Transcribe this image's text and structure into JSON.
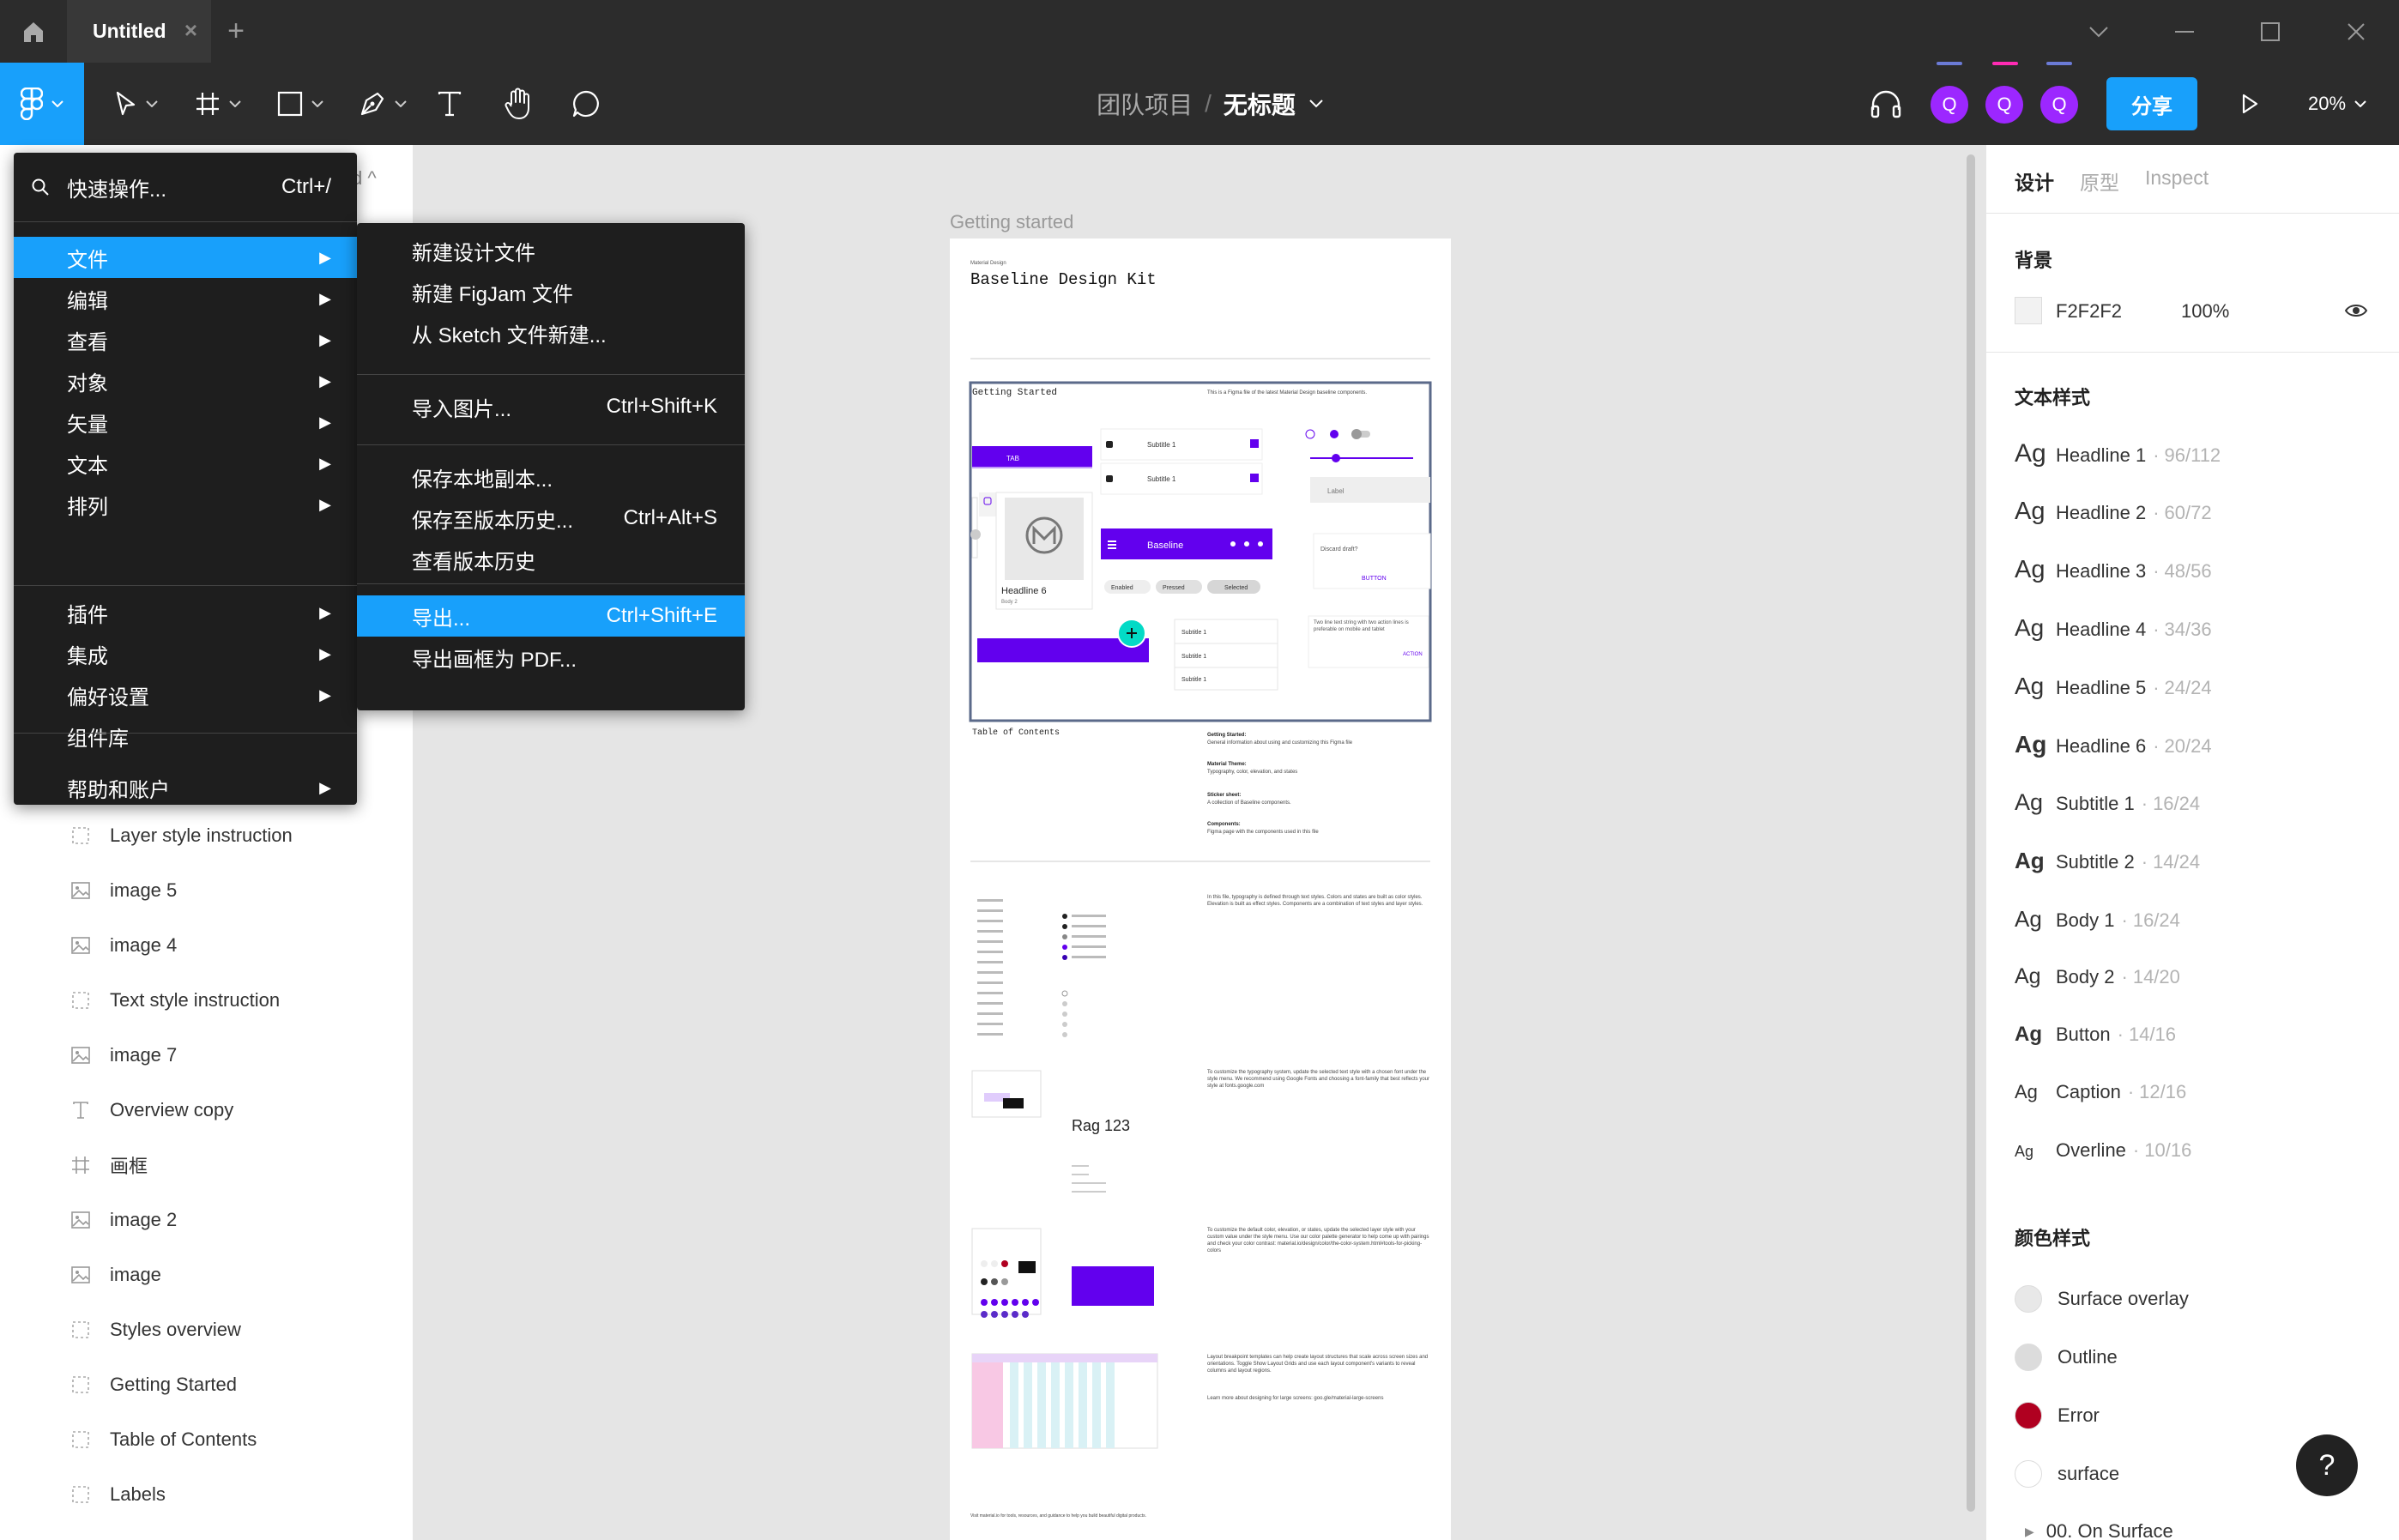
{
  "tab": {
    "title": "Untitled"
  },
  "breadcrumb": {
    "team": "团队项目",
    "separator": "/",
    "file": "无标题"
  },
  "avatars": [
    {
      "label": "Q",
      "color": "#9c27ff",
      "bar": "#6b7bd6"
    },
    {
      "label": "Q",
      "color": "#9c27ff",
      "bar": "#ff2bb3"
    },
    {
      "label": "Q",
      "color": "#9c27ff",
      "bar": "#6b7bd6"
    }
  ],
  "share_label": "分享",
  "zoom_label": "20%",
  "main_menu": {
    "search_label": "快速操作...",
    "search_shortcut": "Ctrl+/",
    "items": [
      {
        "label": "文件"
      },
      {
        "label": "编辑"
      },
      {
        "label": "查看"
      },
      {
        "label": "对象"
      },
      {
        "label": "矢量"
      },
      {
        "label": "文本"
      },
      {
        "label": "排列"
      },
      {
        "label": "插件"
      },
      {
        "label": "集成"
      },
      {
        "label": "偏好设置"
      },
      {
        "label": "组件库"
      },
      {
        "label": "帮助和账户"
      }
    ]
  },
  "file_menu": {
    "items": [
      {
        "label": "新建设计文件",
        "shortcut": ""
      },
      {
        "label": "新建 FigJam 文件",
        "shortcut": ""
      },
      {
        "label": "从 Sketch 文件新建...",
        "shortcut": ""
      },
      {
        "label": "导入图片...",
        "shortcut": "Ctrl+Shift+K"
      },
      {
        "label": "保存本地副本...",
        "shortcut": ""
      },
      {
        "label": "保存至版本历史...",
        "shortcut": "Ctrl+Alt+S"
      },
      {
        "label": "查看版本历史",
        "shortcut": ""
      },
      {
        "label": "导出...",
        "shortcut": "Ctrl+Shift+E"
      },
      {
        "label": "导出画框为 PDF...",
        "shortcut": ""
      }
    ]
  },
  "layers": [
    {
      "name": "Layer style instruction",
      "type": "frame-dashed"
    },
    {
      "name": "image 5",
      "type": "image"
    },
    {
      "name": "image 4",
      "type": "image"
    },
    {
      "name": "Text style instruction",
      "type": "frame-dashed"
    },
    {
      "name": "image 7",
      "type": "image"
    },
    {
      "name": "Overview copy",
      "type": "text"
    },
    {
      "name": "画框",
      "type": "frame"
    },
    {
      "name": "image 2",
      "type": "image"
    },
    {
      "name": "image",
      "type": "image"
    },
    {
      "name": "Styles overview",
      "type": "frame-dashed"
    },
    {
      "name": "Getting Started",
      "type": "frame-dashed"
    },
    {
      "name": "Table of Contents",
      "type": "frame-dashed"
    },
    {
      "name": "Labels",
      "type": "frame-dashed"
    }
  ],
  "canvas": {
    "frame_label": "Getting started",
    "kit_subtitle": "Material Design",
    "kit_title": "Baseline Design Kit",
    "getting_started": "Getting Started",
    "intro": "This is a Figma file of the latest Material Design baseline components.",
    "toc_title": "Table of Contents",
    "toc": [
      {
        "title": "Getting Started:",
        "desc": "General information about using and customizing this Figma file"
      },
      {
        "title": "Material Theme:",
        "desc": "Typography, color, elevation, and states"
      },
      {
        "title": "Sticker sheet:",
        "desc": "A collection of Baseline components."
      },
      {
        "title": "Components:",
        "desc": "Figma page with the components used in this file"
      }
    ],
    "preview": {
      "tab": "TAB",
      "subtitle": "Subtitle 1",
      "label": "Label",
      "headline": "Headline 6",
      "body": "Body 2",
      "baseline": "Baseline",
      "chips": [
        "Enabled",
        "Pressed",
        "Selected"
      ],
      "dialog": "Discard draft?",
      "dialog_button": "BUTTON",
      "snack": "Two line text string with two action lines is preferable on mobile and tablet",
      "action": "ACTION"
    },
    "rag_label": "Rag 123",
    "notes": [
      "In this file, typography is defined through text styles. Colors and states are built as color styles. Elevation is built as effect styles. Components are a combination of text styles and layer styles.",
      "To customize the typography system, update the selected text style with a chosen font under the style menu. We recommend using Google Fonts and choosing a font-family that best reflects your style at fonts.google.com",
      "To customize the default color, elevation, or states, update the selected layer style with your custom value under the style menu. Use our color palette generator to help come up with pairings and check your color contrast: material.io/design/color/the-color-system.html#tools-for-picking-colors",
      "Layout breakpoint templates can help create layout structures that scale across screen sizes and orientations. Toggle Show Layout Grids and use each layout component's variants to reveal columns and layout regions.",
      "Learn more about designing for large screens: goo.gle/material-large-screens"
    ],
    "footer": "Visit material.io for tools, resources, and guidance to help you build beautiful digital products."
  },
  "right_panel": {
    "tabs": [
      "设计",
      "原型",
      "Inspect"
    ],
    "background_title": "背景",
    "background_hex": "F2F2F2",
    "background_opacity": "100%",
    "text_styles_title": "文本样式",
    "text_styles": [
      {
        "name": "Headline 1",
        "spec": "96/112"
      },
      {
        "name": "Headline 2",
        "spec": "60/72"
      },
      {
        "name": "Headline 3",
        "spec": "48/56"
      },
      {
        "name": "Headline 4",
        "spec": "34/36"
      },
      {
        "name": "Headline 5",
        "spec": "24/24"
      },
      {
        "name": "Headline 6",
        "spec": "20/24"
      },
      {
        "name": "Subtitle 1",
        "spec": "16/24"
      },
      {
        "name": "Subtitle 2",
        "spec": "14/24"
      },
      {
        "name": "Body 1",
        "spec": "16/24"
      },
      {
        "name": "Body 2",
        "spec": "14/20"
      },
      {
        "name": "Button",
        "spec": "14/16"
      },
      {
        "name": "Caption",
        "spec": "12/16"
      },
      {
        "name": "Overline",
        "spec": "10/16"
      }
    ],
    "ag_label": "Ag",
    "spec_separator": "·",
    "color_styles_title": "颜色样式",
    "color_styles": [
      {
        "name": "Surface overlay",
        "color": "#e8e8e8"
      },
      {
        "name": "Outline",
        "color": "#dcdcdc"
      },
      {
        "name": "Error",
        "color": "#b00020"
      },
      {
        "name": "surface",
        "color": "#ffffff"
      }
    ],
    "color_group": "00. On Surface"
  },
  "help_label": "?",
  "colors": {
    "accent": "#18a0fb",
    "primary": "#6200ee",
    "secondary": "#03dac6",
    "chrome": "#2c2c2c"
  }
}
